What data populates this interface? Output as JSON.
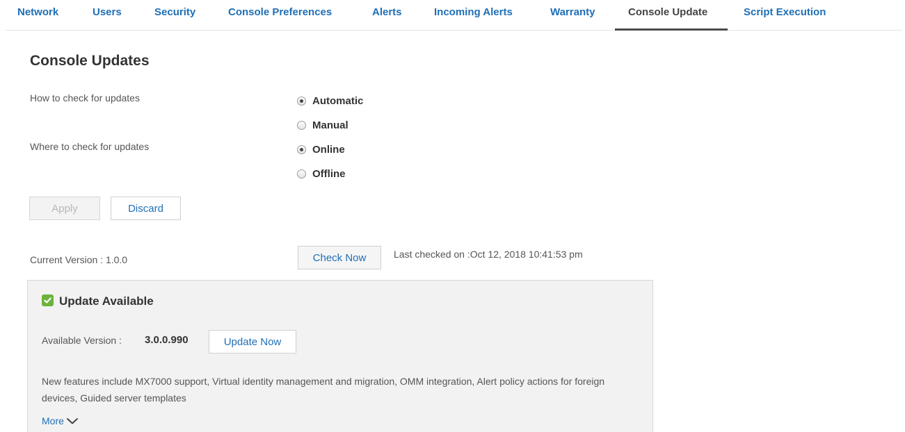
{
  "tabs": [
    {
      "label": "Network"
    },
    {
      "label": "Users"
    },
    {
      "label": "Security"
    },
    {
      "label": "Console Preferences"
    },
    {
      "label": "Alerts"
    },
    {
      "label": "Incoming Alerts"
    },
    {
      "label": "Warranty"
    },
    {
      "label": "Console Update",
      "active": true
    },
    {
      "label": "Script Execution"
    }
  ],
  "page": {
    "title": "Console Updates"
  },
  "how_to_check": {
    "label": "How to check for updates",
    "options": [
      "Automatic",
      "Manual"
    ],
    "selected": "Automatic"
  },
  "where_to_check": {
    "label": "Where to check for updates",
    "options": [
      "Online",
      "Offline"
    ],
    "selected": "Online"
  },
  "actions": {
    "apply_label": "Apply",
    "discard_label": "Discard"
  },
  "version": {
    "current_label": "Current Version : 1.0.0",
    "check_now_label": "Check Now",
    "last_checked": "Last checked on :Oct 12, 2018 10:41:53 pm"
  },
  "update": {
    "heading": "Update Available",
    "available_label": "Available Version :",
    "available_value": "3.0.0.990",
    "update_now_label": "Update Now",
    "description": "New features include MX7000 support, Virtual identity management and migration, OMM integration, Alert policy actions for foreign devices, Guided server templates",
    "more_label": "More"
  },
  "colors": {
    "link": "#1f6fb6",
    "success": "#6cb33e",
    "panel_bg": "#f2f2f2"
  },
  "icons": [
    "check-square-icon",
    "chevron-down-icon"
  ]
}
